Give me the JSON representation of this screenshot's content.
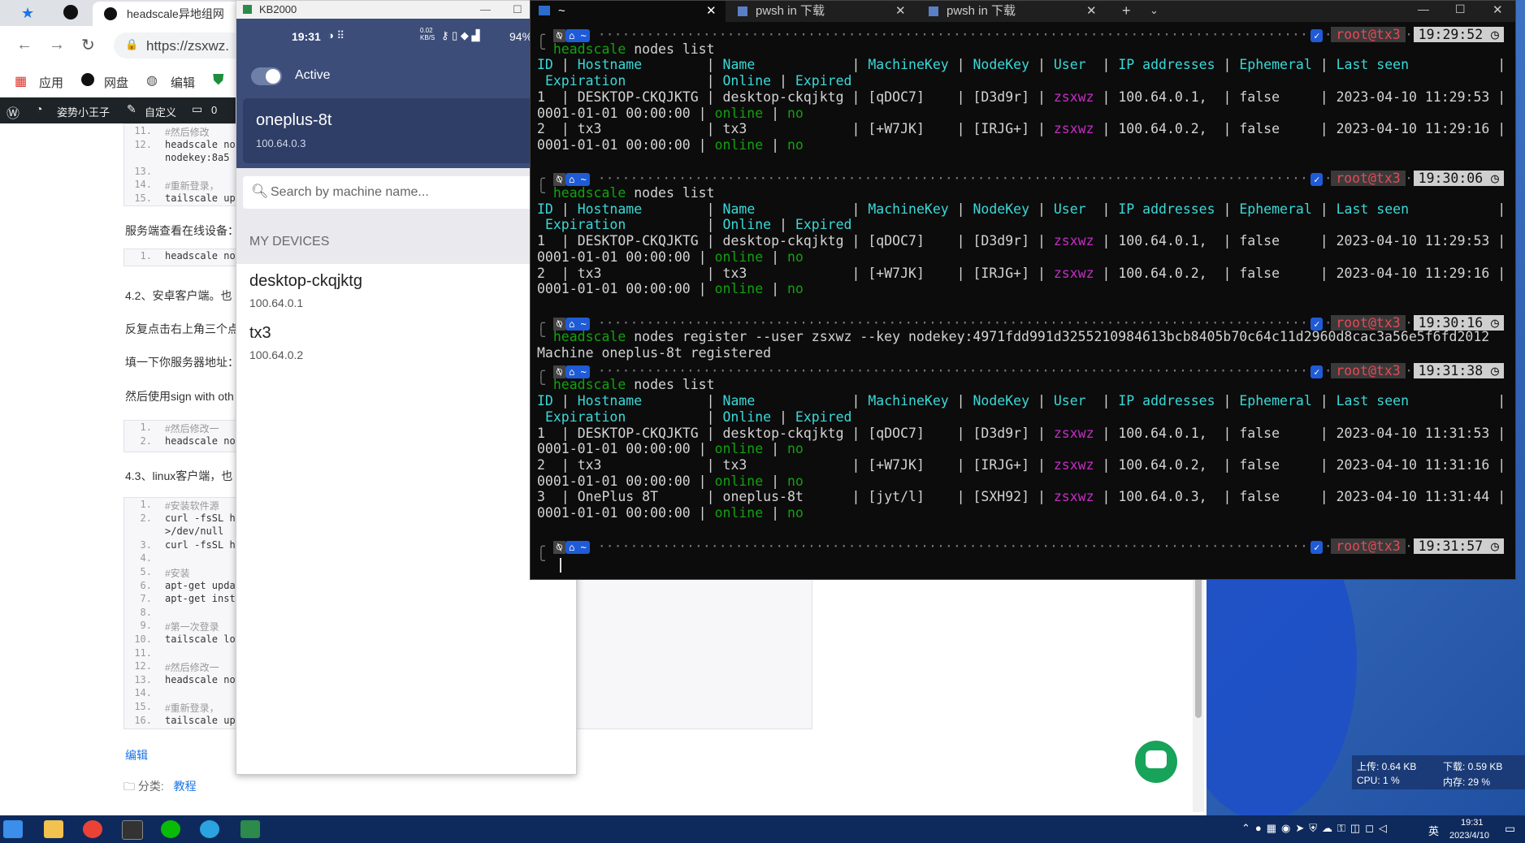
{
  "browser": {
    "tab_title": "headscale异地组网",
    "url": "https://zsxwz.",
    "bookmarks": [
      "应用",
      "网盘",
      "编辑"
    ],
    "wpbar": {
      "site": "姿势小王子",
      "customize": "自定义",
      "comments": "0"
    },
    "article": {
      "code1": [
        {
          "n": "11.",
          "t": "#然后修改"
        },
        {
          "n": "12.",
          "t": "headscale no"
        },
        {
          "n": "",
          "t": "nodekey:8a5"
        },
        {
          "n": "13.",
          "t": ""
        },
        {
          "n": "14.",
          "t": "#重新登录，"
        },
        {
          "n": "15.",
          "t": "tailscale up -"
        }
      ],
      "p1": "服务端查看在线设备：",
      "code2": [
        {
          "n": "1.",
          "t": "headscale no"
        }
      ],
      "p2": "4.2、安卓客户端。也",
      "p3": "反复点击右上角三个点",
      "p4": "填一下你服务器地址：",
      "p5": "然后使用sign with oth",
      "code3": [
        {
          "n": "1.",
          "t": "#然后修改一"
        },
        {
          "n": "2.",
          "t": "headscale no"
        }
      ],
      "p6": "4.3、linux客户端，也",
      "code4": [
        {
          "n": "1.",
          "t": "#安装软件源"
        },
        {
          "n": "2.",
          "t": "curl -fsSL htt"
        },
        {
          "n": "",
          "t": ">/dev/null"
        },
        {
          "n": "3.",
          "t": "curl -fsSL htt"
        },
        {
          "n": "4.",
          "t": ""
        },
        {
          "n": "5.",
          "t": "#安装"
        },
        {
          "n": "6.",
          "t": "apt-get upda"
        },
        {
          "n": "7.",
          "t": "apt-get insta"
        },
        {
          "n": "8.",
          "t": ""
        },
        {
          "n": "9.",
          "t": "#第一次登录"
        },
        {
          "n": "10.",
          "t": "tailscale logi"
        },
        {
          "n": "11.",
          "t": ""
        },
        {
          "n": "12.",
          "t": "#然后修改一"
        },
        {
          "n": "13.",
          "t": "headscale no"
        },
        {
          "n": "14.",
          "t": ""
        },
        {
          "n": "15.",
          "t": "#重新登录，"
        },
        {
          "n": "16.",
          "t": "tailscale up -"
        }
      ],
      "edit_link": "编辑",
      "category_label": "分类:",
      "category_value": "教程"
    }
  },
  "phone": {
    "window_title": "KB2000",
    "status": {
      "time": "19:31",
      "speed": "0.02 KB/S",
      "battery": "94%"
    },
    "active_label": "Active",
    "node": {
      "name": "oneplus-8t",
      "ip": "100.64.0.3"
    },
    "search_placeholder": "Search by machine name...",
    "section_label": "MY DEVICES",
    "devices": [
      {
        "name": "desktop-ckqjktg",
        "ip": "100.64.0.1"
      },
      {
        "name": "tx3",
        "ip": "100.64.0.2"
      }
    ]
  },
  "terminal": {
    "tabs": [
      "~",
      "pwsh in 下载",
      "pwsh in 下载"
    ],
    "prompt_home": "~",
    "prompt_user": "root@tx3",
    "blocks": [
      {
        "time": "19:29:52",
        "cmd_prefix": "headscale",
        "cmd": " nodes list",
        "table": true,
        "rows": [
          {
            "id": "1",
            "host": "DESKTOP-CKQJKTG",
            "name": "desktop-ckqjktg",
            "mkey": "[qDOC7]",
            "nkey": "[D3d9r]",
            "user": "zsxwz",
            "ip": "100.64.0.1,",
            "eph": "false",
            "seen": "2023-04-10 11:29:53",
            "exp": "0001-01-01 00:00:00",
            "online": "online",
            "expired": "no"
          },
          {
            "id": "2",
            "host": "tx3",
            "name": "tx3",
            "mkey": "[+W7JK]",
            "nkey": "[IRJG+]",
            "user": "zsxwz",
            "ip": "100.64.0.2,",
            "eph": "false",
            "seen": "2023-04-10 11:29:16",
            "exp": "0001-01-01 00:00:00",
            "online": "online",
            "expired": "no"
          }
        ]
      },
      {
        "time": "19:30:06",
        "cmd_prefix": "headscale",
        "cmd": " nodes list",
        "table": true,
        "rows": [
          {
            "id": "1",
            "host": "DESKTOP-CKQJKTG",
            "name": "desktop-ckqjktg",
            "mkey": "[qDOC7]",
            "nkey": "[D3d9r]",
            "user": "zsxwz",
            "ip": "100.64.0.1,",
            "eph": "false",
            "seen": "2023-04-10 11:29:53",
            "exp": "0001-01-01 00:00:00",
            "online": "online",
            "expired": "no"
          },
          {
            "id": "2",
            "host": "tx3",
            "name": "tx3",
            "mkey": "[+W7JK]",
            "nkey": "[IRJG+]",
            "user": "zsxwz",
            "ip": "100.64.0.2,",
            "eph": "false",
            "seen": "2023-04-10 11:29:16",
            "exp": "0001-01-01 00:00:00",
            "online": "online",
            "expired": "no"
          }
        ]
      },
      {
        "time": "19:30:16",
        "cmd_prefix": "headscale",
        "cmd": " nodes register --user zsxwz --key nodekey:4971fdd991d3255210984613bcb8405b70c64c11d2960d8cac3a56e5f6fd2012",
        "output": "Machine oneplus-8t registered"
      },
      {
        "time": "19:31:38",
        "cmd_prefix": "headscale",
        "cmd": " nodes list",
        "table": true,
        "rows": [
          {
            "id": "1",
            "host": "DESKTOP-CKQJKTG",
            "name": "desktop-ckqjktg",
            "mkey": "[qDOC7]",
            "nkey": "[D3d9r]",
            "user": "zsxwz",
            "ip": "100.64.0.1,",
            "eph": "false",
            "seen": "2023-04-10 11:31:53",
            "exp": "0001-01-01 00:00:00",
            "online": "online",
            "expired": "no"
          },
          {
            "id": "2",
            "host": "tx3",
            "name": "tx3",
            "mkey": "[+W7JK]",
            "nkey": "[IRJG+]",
            "user": "zsxwz",
            "ip": "100.64.0.2,",
            "eph": "false",
            "seen": "2023-04-10 11:31:16",
            "exp": "0001-01-01 00:00:00",
            "online": "online",
            "expired": "no"
          },
          {
            "id": "3",
            "host": "OnePlus 8T",
            "name": "oneplus-8t",
            "mkey": "[jyt/l]",
            "nkey": "[SXH92]",
            "user": "zsxwz",
            "ip": "100.64.0.3,",
            "eph": "false",
            "seen": "2023-04-10 11:31:44",
            "exp": "0001-01-01 00:00:00",
            "online": "online",
            "expired": "no"
          }
        ]
      },
      {
        "time": "19:31:57",
        "cmd_prefix": "",
        "cmd": ""
      }
    ],
    "headers": {
      "id": "ID",
      "host": "Hostname",
      "name": "Name",
      "mkey": "MachineKey",
      "nkey": "NodeKey",
      "user": "User",
      "ip": "IP addresses",
      "eph": "Ephemeral",
      "seen": "Last seen",
      "exp": "Expiration",
      "online": "Online",
      "expired": "Expired"
    }
  },
  "netmon": {
    "up": "上传: 0.64 KB",
    "down": "下载: 0.59 KB",
    "cpu": "CPU: 1 %",
    "mem": "内存: 29 %"
  },
  "taskbar": {
    "time": "19:31",
    "date": "2023/4/10",
    "ime": "英"
  }
}
